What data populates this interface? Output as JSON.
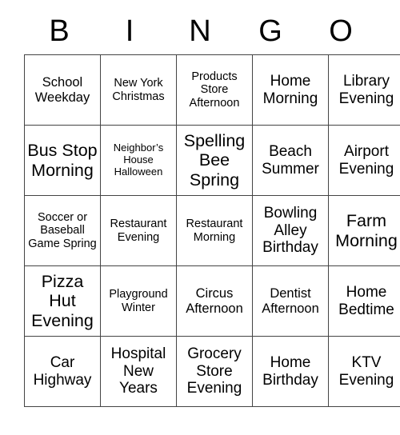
{
  "card": {
    "header_letters": [
      "B",
      "I",
      "N",
      "G",
      "O"
    ],
    "grid_border_color": "#444444",
    "text_color": "#000000",
    "background_color": "#ffffff",
    "rows": [
      [
        {
          "text": "School Weekday",
          "size": "md"
        },
        {
          "text": "New York Christmas",
          "size": "sm"
        },
        {
          "text": "Products Store Afternoon",
          "size": "sm"
        },
        {
          "text": "Home Morning",
          "size": "lg"
        },
        {
          "text": "Library Evening",
          "size": "lg"
        }
      ],
      [
        {
          "text": "Bus Stop Morning",
          "size": "xl"
        },
        {
          "text": "Neighbor’s House Halloween",
          "size": "xs"
        },
        {
          "text": "Spelling Bee Spring",
          "size": "xl"
        },
        {
          "text": "Beach Summer",
          "size": "lg"
        },
        {
          "text": "Airport Evening",
          "size": "lg"
        }
      ],
      [
        {
          "text": "Soccer or Baseball Game Spring",
          "size": "sm"
        },
        {
          "text": "Restaurant Evening",
          "size": "sm"
        },
        {
          "text": "Restaurant Morning",
          "size": "sm"
        },
        {
          "text": "Bowling Alley Birthday",
          "size": "lg"
        },
        {
          "text": "Farm Morning",
          "size": "xl"
        }
      ],
      [
        {
          "text": "Pizza Hut Evening",
          "size": "xl"
        },
        {
          "text": "Playground Winter",
          "size": "sm"
        },
        {
          "text": "Circus Afternoon",
          "size": "md"
        },
        {
          "text": "Dentist Afternoon",
          "size": "md"
        },
        {
          "text": "Home Bedtime",
          "size": "lg"
        }
      ],
      [
        {
          "text": "Car Highway",
          "size": "lg"
        },
        {
          "text": "Hospital New Years",
          "size": "lg"
        },
        {
          "text": "Grocery Store Evening",
          "size": "lg"
        },
        {
          "text": "Home Birthday",
          "size": "lg"
        },
        {
          "text": "KTV Evening",
          "size": "lg"
        }
      ]
    ]
  }
}
